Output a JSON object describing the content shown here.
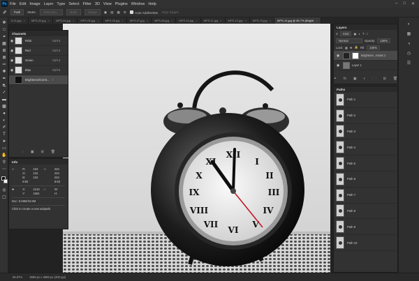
{
  "app": {
    "logo": "Ps"
  },
  "menubar": {
    "items": [
      "File",
      "Edit",
      "Image",
      "Layer",
      "Type",
      "Select",
      "Filter",
      "3D",
      "View",
      "Plugins",
      "Window",
      "Help"
    ]
  },
  "options": {
    "mode": "Path",
    "make_label": "Make:",
    "selection": "Selection...",
    "mask": "Mask",
    "shape": "Shape",
    "auto_add_delete": "Auto Add/Delete",
    "align_edges": "Align Edges"
  },
  "tabs": [
    "5-01.jpg",
    "MPS-02.jpg",
    "MPS-04.jpg",
    "MPS-05.jpg",
    "MPS-06.jpg",
    "MPS-07.jpg",
    "MPS-08.jpg",
    "MPS-10.jpg",
    "MPS-11.jpg",
    "MPS-12.jpg",
    "MPS-13.jpg",
    "MPS-14.jpg @ 66.7% (Brighti"
  ],
  "channels": {
    "title": "Channels",
    "rows": [
      {
        "name": "RGB",
        "key": "Ctrl+2"
      },
      {
        "name": "Red",
        "key": "Ctrl+3"
      },
      {
        "name": "Green",
        "key": "Ctrl+4"
      },
      {
        "name": "Blue",
        "key": "Ctrl+5"
      },
      {
        "name": "Brightness/Contr...",
        "key": "\\"
      }
    ]
  },
  "info": {
    "title": "Info",
    "r": "R:",
    "g": "G:",
    "b": "B:",
    "r1": "234",
    "g1": "234",
    "b1": "234",
    "r2": "234",
    "g2": "234",
    "b2": "234",
    "bit1": "8-bit",
    "bit2": "8-bit",
    "x_label": "X:",
    "y_label": "Y:",
    "x_val": "2216",
    "y_val": "1581",
    "w_label": "W:",
    "h_label": "H:",
    "doc": "Doc: 8.06M/23.8M",
    "hint": "Click to create a new subpath."
  },
  "layers": {
    "title": "Layers",
    "kind": "Kind",
    "blend": "Normal",
    "opacity_label": "Opacity:",
    "opacity": "100%",
    "lock_label": "Lock:",
    "fill_label": "Fill:",
    "fill": "100%",
    "items": [
      {
        "name": "Brightnes...ntrast 1"
      },
      {
        "name": "Layer 1"
      }
    ]
  },
  "paths": {
    "title": "Paths",
    "items": [
      "Path 1",
      "Path 2",
      "Path 3",
      "Path 4",
      "Path 5",
      "Path 6",
      "Path 7",
      "Path 8",
      "Path 9",
      "Path 10"
    ]
  },
  "status": {
    "zoom": "66.67%",
    "dims": "3888 px x 3888 px (300 ppi)"
  }
}
